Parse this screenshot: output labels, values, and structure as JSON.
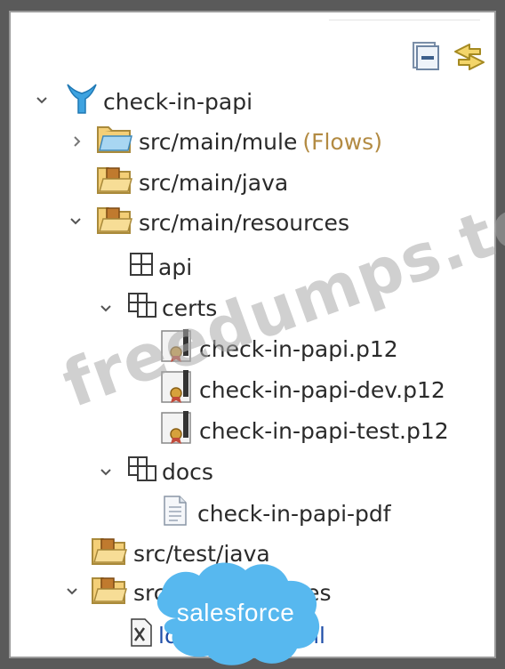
{
  "toolbar": {
    "collapse_icon": "collapse-all-icon",
    "link_icon": "link-with-editor-icon"
  },
  "tree": {
    "project": "check-in-papi",
    "mule": {
      "label": "src/main/mule",
      "decoration": "(Flows)"
    },
    "main_java": "src/main/java",
    "main_resources": "src/main/resources",
    "api": "api",
    "certs": "certs",
    "cert_files": [
      "check-in-papi.p12",
      "check-in-papi-dev.p12",
      "check-in-papi-test.p12"
    ],
    "docs": "docs",
    "docs_file": "check-in-papi-pdf",
    "test_java": "src/test/java",
    "test_resources": "src/test/resources",
    "log_file": "log4j2-test.xml"
  },
  "overlays": {
    "watermark": "freedumps.top",
    "salesforce_logo": "salesforce"
  }
}
